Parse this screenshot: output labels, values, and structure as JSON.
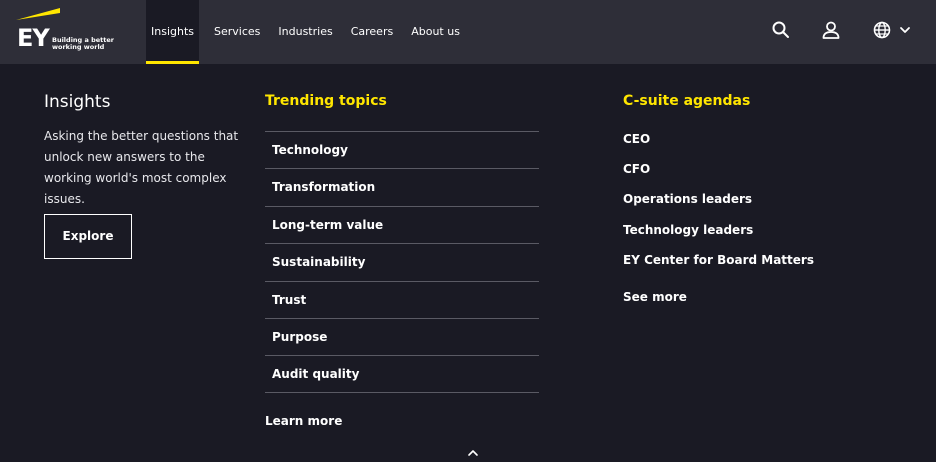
{
  "header": {
    "logo_text": "EY",
    "tagline_line1": "Building a better",
    "tagline_line2": "working world",
    "nav": [
      {
        "label": "Insights",
        "active": true
      },
      {
        "label": "Services"
      },
      {
        "label": "Industries"
      },
      {
        "label": "Careers"
      },
      {
        "label": "About us"
      }
    ],
    "icons": [
      "search-icon",
      "user-icon",
      "globe-icon",
      "chevron-down-icon"
    ],
    "accent_color": "#ffe600"
  },
  "intro": {
    "title": "Insights",
    "description": "Asking the better questions that unlock new answers to the working world's most complex issues.",
    "button_label": "Explore"
  },
  "trending": {
    "heading": "Trending topics",
    "items": [
      "Technology",
      "Transformation",
      "Long-term value",
      "Sustainability",
      "Trust",
      "Purpose",
      "Audit quality"
    ],
    "learn_more": "Learn more"
  },
  "csuite": {
    "heading": "C-suite agendas",
    "items": [
      "CEO",
      "CFO",
      "Operations leaders",
      "Technology leaders",
      "EY Center for Board Matters"
    ],
    "see_more": "See more"
  },
  "footer_icons": [
    "chevron-up-icon"
  ]
}
